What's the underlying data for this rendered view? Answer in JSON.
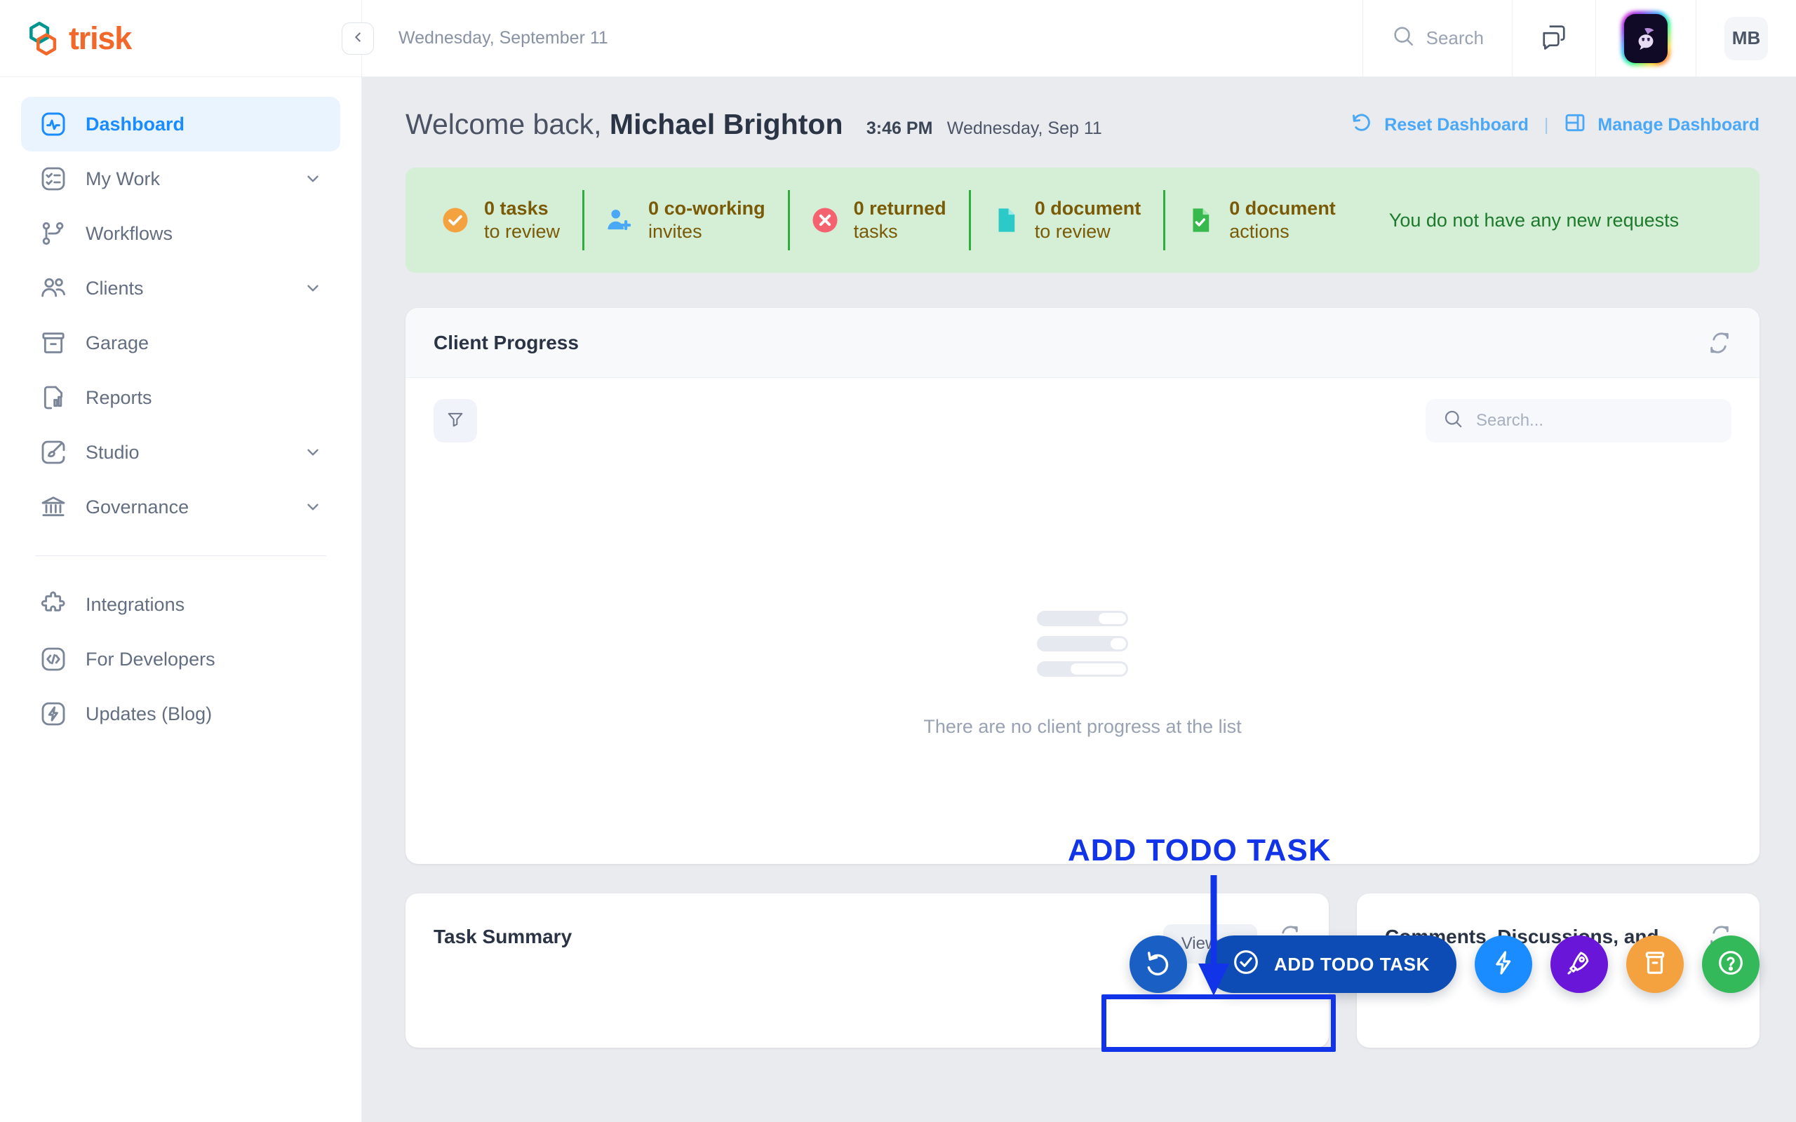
{
  "topbar": {
    "logo_text": "trisk",
    "logo_icon": "hexagon-link-icon",
    "collapse_icon": "chevron-left-icon",
    "date": "Wednesday, September 11",
    "search_label": "Search",
    "search_icon": "search-icon",
    "chat_icon": "chat-bubbles-icon",
    "ai_icon": "ai-assistant-avatar",
    "avatar_initials": "MB"
  },
  "sidebar": {
    "items": [
      {
        "label": "Dashboard",
        "icon": "activity-pulse-icon",
        "active": true,
        "chevron": false
      },
      {
        "label": "My Work",
        "icon": "checklist-icon",
        "active": false,
        "chevron": true
      },
      {
        "label": "Workflows",
        "icon": "git-branch-icon",
        "active": false,
        "chevron": false
      },
      {
        "label": "Clients",
        "icon": "users-icon",
        "active": false,
        "chevron": true
      },
      {
        "label": "Garage",
        "icon": "archive-box-icon",
        "active": false,
        "chevron": false
      },
      {
        "label": "Reports",
        "icon": "document-chart-icon",
        "active": false,
        "chevron": false
      },
      {
        "label": "Studio",
        "icon": "brush-square-icon",
        "active": false,
        "chevron": true
      },
      {
        "label": "Governance",
        "icon": "bank-columns-icon",
        "active": false,
        "chevron": true
      }
    ],
    "secondary_items": [
      {
        "label": "Integrations",
        "icon": "puzzle-piece-icon"
      },
      {
        "label": "For Developers",
        "icon": "code-brackets-icon"
      },
      {
        "label": "Updates (Blog)",
        "icon": "lightning-square-icon"
      }
    ]
  },
  "header": {
    "welcome_prefix": "Welcome back,",
    "user_name": "Michael Brighton",
    "time": "3:46 PM",
    "date": "Wednesday, Sep 11",
    "reset_label": "Reset Dashboard",
    "reset_icon": "undo-circular-icon",
    "separator": "|",
    "manage_label": "Manage Dashboard",
    "manage_icon": "layout-panels-icon"
  },
  "status_strip": {
    "background_color": "#d4efd5",
    "text_color": "#7a5a06",
    "divider_color": "#2fae3f",
    "items": [
      {
        "count": "0",
        "line1": "tasks",
        "line2": "to review",
        "icon": "check-circle-icon",
        "icon_color": "#f4a23f"
      },
      {
        "count": "0",
        "line1": "co-working",
        "line2": "invites",
        "icon": "user-plus-icon",
        "icon_color": "#4aa8f7"
      },
      {
        "count": "0",
        "line1": "returned",
        "line2": "tasks",
        "icon": "x-circle-icon",
        "icon_color": "#f4626f"
      },
      {
        "count": "0",
        "line1": "document",
        "line2": "to review",
        "icon": "document-icon",
        "icon_color": "#2cc9c9"
      },
      {
        "count": "0",
        "line1": "document",
        "line2": "actions",
        "icon": "document-check-icon",
        "icon_color": "#37b94e"
      }
    ],
    "message": "You do not have any new requests",
    "message_color": "#1d7a2c"
  },
  "client_progress": {
    "title": "Client Progress",
    "refresh_icon": "refresh-icon",
    "filter_icon": "funnel-filter-icon",
    "search_placeholder": "Search...",
    "search_icon": "search-icon",
    "empty_text": "There are no client progress at the list",
    "placeholder_icon": "progress-bars-placeholder"
  },
  "bottom_cards": {
    "task_summary": {
      "title": "Task Summary",
      "view_all_label": "View all",
      "refresh_icon": "refresh-icon"
    },
    "comments": {
      "title": "Comments, Discussions, and Notes",
      "refresh_icon": "refresh-icon"
    }
  },
  "fab_bar": {
    "undo": {
      "icon": "undo-arrow-icon",
      "color": "#1a5fc4"
    },
    "todo": {
      "label": "ADD TODO TASK",
      "icon": "check-circle-icon",
      "color": "#0d4cb5"
    },
    "automation": {
      "icon": "lightning-bolt-icon",
      "color": "#1a8cff"
    },
    "launch": {
      "icon": "rocket-icon",
      "color": "#6a16d8"
    },
    "garage": {
      "icon": "archive-box-icon",
      "color": "#f4a23f"
    },
    "help": {
      "icon": "question-circle-icon",
      "color": "#33b85a"
    }
  },
  "annotation": {
    "label": "ADD TODO TASK",
    "color": "#1134e8",
    "arrow_icon": "down-arrow-annotation",
    "highlight_icon": "highlight-box-annotation"
  }
}
